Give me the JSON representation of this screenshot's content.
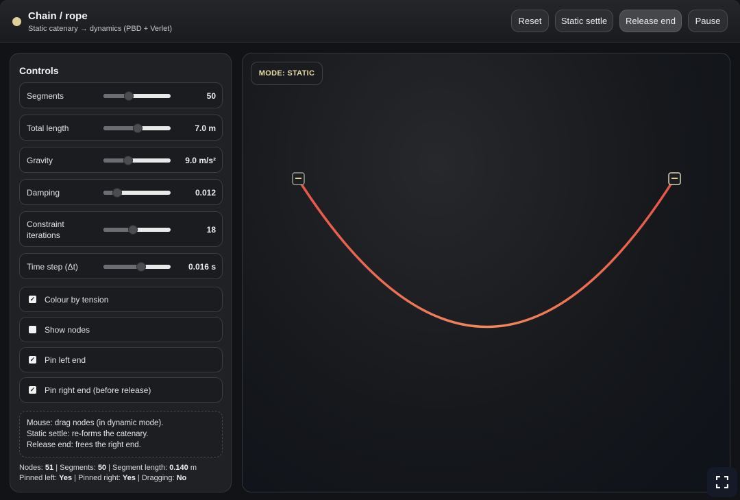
{
  "header": {
    "title": "Chain / rope",
    "subtitle": "Static catenary → dynamics (PBD + Verlet)",
    "buttons": {
      "reset": "Reset",
      "static_settle": "Static settle",
      "release_end": "Release end",
      "pause": "Pause"
    }
  },
  "controls": {
    "title": "Controls",
    "sliders": [
      {
        "label": "Segments",
        "value": "50",
        "level": 0.38
      },
      {
        "label": "Total length",
        "value": "7.0 m",
        "level": 0.51
      },
      {
        "label": "Gravity",
        "value": "9.0 m/s²",
        "level": 0.37
      },
      {
        "label": "Damping",
        "value": "0.012",
        "level": 0.2
      },
      {
        "label": "Constraint iterations",
        "value": "18",
        "level": 0.44
      },
      {
        "label": "Time step (Δt)",
        "value": "0.016 s",
        "level": 0.56
      }
    ],
    "checkboxes": [
      {
        "label": "Colour by tension",
        "checked": true
      },
      {
        "label": "Show nodes",
        "checked": false
      },
      {
        "label": "Pin left end",
        "checked": true
      },
      {
        "label": "Pin right end (before release)",
        "checked": true
      }
    ],
    "help": [
      "Mouse: drag nodes (in dynamic mode).",
      "Static settle: re-forms the catenary.",
      "Release end: frees the right end."
    ],
    "stats": {
      "nodes_label": "Nodes:",
      "nodes": "51",
      "segments_label": "Segments:",
      "segments": "50",
      "seglen_label": "Segment length:",
      "seglen": "0.140",
      "seglen_unit": "m",
      "pinned_left_label": "Pinned left:",
      "pinned_left": "Yes",
      "pinned_right_label": "Pinned right:",
      "pinned_right": "Yes",
      "dragging_label": "Dragging:",
      "dragging": "No"
    }
  },
  "canvas": {
    "mode_label": "MODE: STATIC",
    "rope_color_end": "#e8554a",
    "rope_color_mid": "#f08a5e",
    "pin_color": "#e0cf9a"
  },
  "icons": {
    "status": "status-dot",
    "fullscreen": "fullscreen-icon"
  }
}
